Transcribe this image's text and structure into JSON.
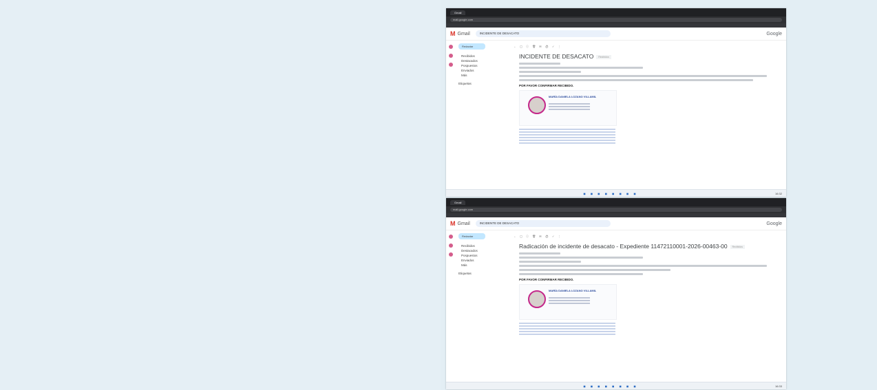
{
  "screens": [
    {
      "browser": {
        "tab": "Gmail",
        "url": "mail.google.com"
      },
      "gmail": {
        "logo": "Gmail",
        "search": "INCIDENTE DE DESACATO",
        "brand": "Google",
        "compose": "Redactar",
        "nav": [
          "Recibidos",
          "Destacados",
          "Pospuestos",
          "Enviados",
          "Más"
        ],
        "labels_title": "Etiquetas",
        "subject": "INCIDENTE DE DESACATO",
        "label_chip": "Recibidos",
        "body_heading": "POR FAVOR CONFIRMAR RECIBIDO.",
        "signature_name": "MARÍA DANIELA LOZANO VILLAMIL"
      },
      "taskbar": {
        "clock": "16:32"
      }
    },
    {
      "browser": {
        "tab": "Gmail",
        "url": "mail.google.com"
      },
      "gmail": {
        "logo": "Gmail",
        "search": "INCIDENTE DE DESACATO",
        "brand": "Google",
        "compose": "Redactar",
        "nav": [
          "Recibidos",
          "Destacados",
          "Pospuestos",
          "Enviados",
          "Más"
        ],
        "labels_title": "Etiquetas",
        "subject": "Radicación de incidente de desacato - Expediente 11472110001-2026-00463-00",
        "label_chip": "Recibidos",
        "body_heading": "POR FAVOR CONFIRMAR RECIBIDO.",
        "signature_name": "MARÍA DANIELA LOZANO VILLAMIL"
      },
      "taskbar": {
        "clock": "16:33"
      }
    }
  ]
}
